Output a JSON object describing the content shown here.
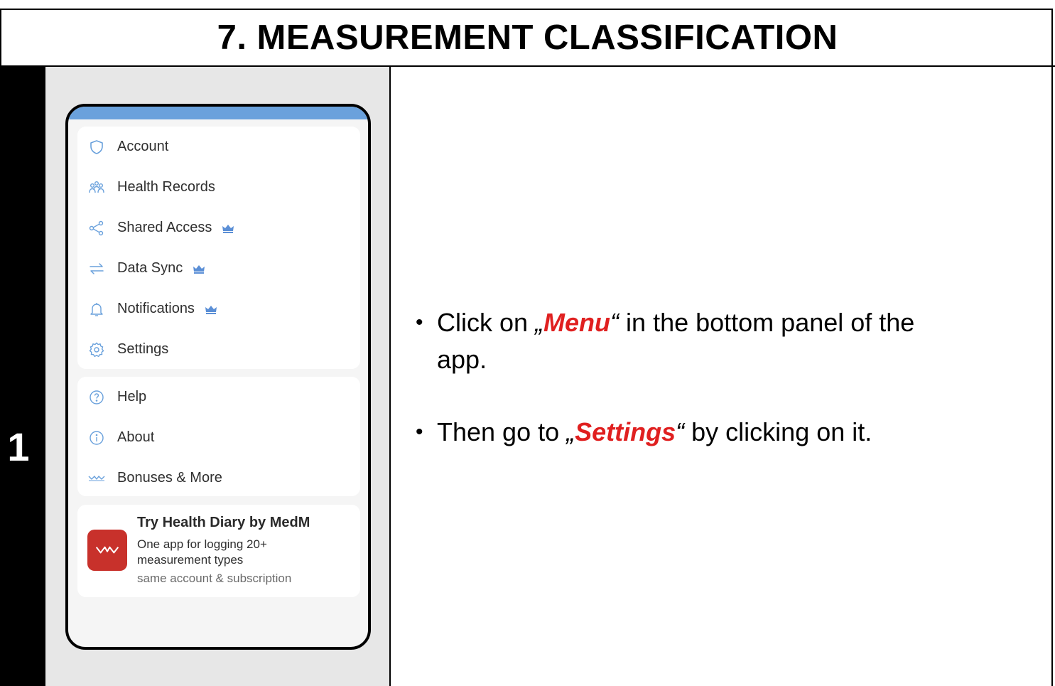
{
  "header": {
    "title": "7. MEASUREMENT CLASSIFICATION"
  },
  "step": {
    "number": "1"
  },
  "phone": {
    "menu_items": [
      {
        "label": "Account",
        "icon": "shield-icon",
        "premium": false
      },
      {
        "label": "Health Records",
        "icon": "people-icon",
        "premium": false
      },
      {
        "label": "Shared Access",
        "icon": "share-icon",
        "premium": true
      },
      {
        "label": "Data Sync",
        "icon": "sync-icon",
        "premium": true
      },
      {
        "label": "Notifications",
        "icon": "bell-icon",
        "premium": true
      },
      {
        "label": "Settings",
        "icon": "gear-icon",
        "premium": false
      }
    ],
    "secondary_items": [
      {
        "label": "Help",
        "icon": "help-icon"
      },
      {
        "label": "About",
        "icon": "info-icon"
      },
      {
        "label": "Bonuses & More",
        "icon": "medm-logo-icon"
      }
    ],
    "promo": {
      "title": "Try Health Diary by MedM",
      "line1": "One app for logging 20+",
      "line2": "measurement types",
      "note": "same account & subscription"
    },
    "colors": {
      "topbar": "#6aa1dc",
      "crown": "#5b8fd6",
      "promo_logo": "#c8312b"
    }
  },
  "instructions": {
    "step1_prefix": "Click on ",
    "step1_open_quote": "„",
    "step1_highlight": "Menu",
    "step1_close_quote": "“",
    "step1_suffix": " in the bottom panel of the",
    "step1_suffix2": "app.",
    "step2_prefix": "Then go to ",
    "step2_open_quote": "„",
    "step2_highlight": "Settings",
    "step2_close_quote": "“",
    "step2_suffix": " by clicking on it.",
    "highlight_color": "#e02020"
  }
}
